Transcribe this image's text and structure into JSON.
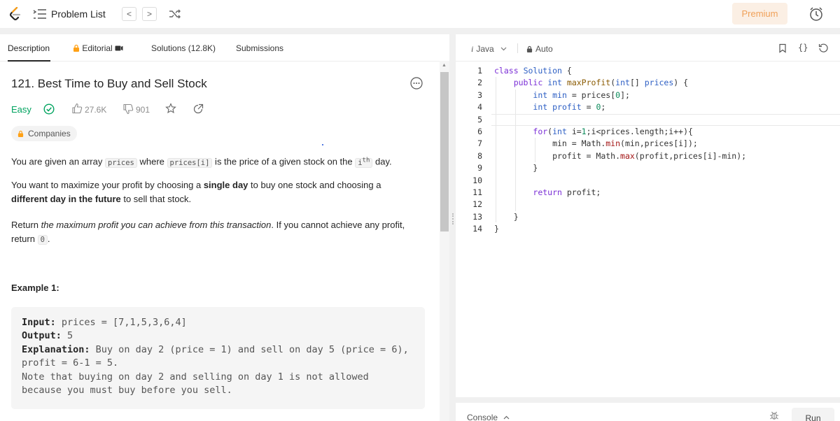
{
  "topbar": {
    "problem_list": "Problem List",
    "prev": "<",
    "next": ">",
    "premium": "Premium"
  },
  "tabs": {
    "description": "Description",
    "editorial": "Editorial",
    "solutions": "Solutions (12.8K)",
    "submissions": "Submissions"
  },
  "problem": {
    "title": "121. Best Time to Buy and Sell Stock",
    "difficulty": "Easy",
    "likes": "27.6K",
    "dislikes": "901",
    "companies": "Companies"
  },
  "description": {
    "p1_a": "You are given an array ",
    "p1_code1": "prices",
    "p1_b": " where ",
    "p1_code2": "prices[i]",
    "p1_c": " is the price of a given stock on the ",
    "p1_code3": "i",
    "p1_sup": "th",
    "p1_d": " day.",
    "p2_a": "You want to maximize your profit by choosing a ",
    "p2_bold1": "single day",
    "p2_b": " to buy one stock and choosing a",
    "p2_bold2": "different day in the future",
    "p2_c": " to sell that stock.",
    "p3_a": "Return ",
    "p3_italic": "the maximum profit you can achieve from this transaction",
    "p3_b": ". If you cannot achieve any profit,",
    "p3_c": "return ",
    "p3_code": "0",
    "p3_d": "."
  },
  "example": {
    "title": "Example 1:",
    "input_label": "Input:",
    "input_value": " prices = [7,1,5,3,6,4]",
    "output_label": "Output:",
    "output_value": " 5",
    "explanation_label": "Explanation:",
    "explanation_value": " Buy on day 2 (price = 1) and sell on day 5 (price = 6),",
    "explanation_line2": "profit = 6-1 = 5.",
    "note_line1": "Note that buying on day 2 and selling on day 1 is not allowed",
    "note_line2": "because you must buy before you sell."
  },
  "editor": {
    "language": "Java",
    "mode": "Auto",
    "braces": "{}",
    "line_numbers": [
      "1",
      "2",
      "3",
      "4",
      "5",
      "6",
      "7",
      "8",
      "9",
      "10",
      "11",
      "12",
      "13",
      "14"
    ]
  },
  "console": {
    "label": "Console",
    "run": "Run"
  },
  "colors": {
    "easy": "#00a35f",
    "premium_text": "#f0a058",
    "premium_bg": "#fbefe4",
    "keyword": "#7b2fd6",
    "type": "#2d5fc4",
    "number": "#0b8a5a"
  },
  "icons": [
    "leetcode-logo-icon",
    "list-icon",
    "shuffle-icon",
    "clock-icon",
    "lock-icon",
    "video-icon",
    "more-icon",
    "check-circle-icon",
    "thumbs-up-icon",
    "thumbs-down-icon",
    "star-icon",
    "share-icon",
    "bookmark-icon",
    "reset-icon",
    "bug-icon",
    "chevron-down-icon",
    "chevron-up-icon"
  ]
}
